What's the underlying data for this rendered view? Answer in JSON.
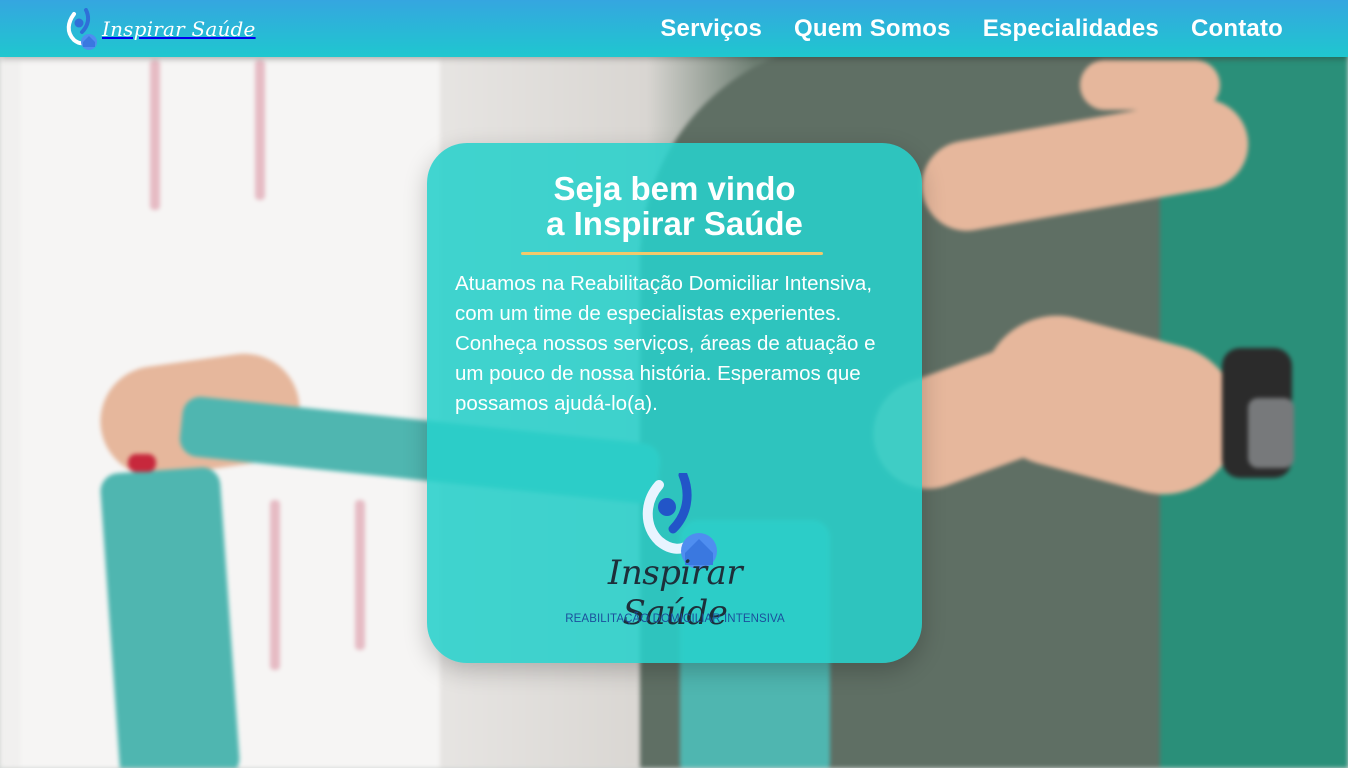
{
  "header": {
    "brand_name": "Inspirar Saúde",
    "brand_icon": "person-house-logo-icon",
    "nav": [
      {
        "label": "Serviços"
      },
      {
        "label": "Quem Somos"
      },
      {
        "label": "Especialidades"
      },
      {
        "label": "Contato"
      }
    ],
    "colors": {
      "gradient_top": "#35a6e0",
      "gradient_bottom": "#1fc7cf",
      "text": "#ffffff"
    }
  },
  "hero": {
    "title_line1": "Seja bem vindo",
    "title_line2": "a Inspirar Saúde",
    "description": "Atuamos na Reabilitação Domiciliar Intensiva, com um time de especialistas experientes. Conheça nossos serviços, áreas de atuação e um pouco de nossa história. Esperamos que possamos ajudá-lo(a).",
    "logo": {
      "name": "Inspirar Saúde",
      "tagline": "REABILITAÇÃO DOMICILIAR INTENSIVA",
      "icon": "person-house-logo-icon"
    },
    "colors": {
      "card": "#28d0cb",
      "rule": "#f2c96b",
      "text": "#ffffff"
    }
  }
}
